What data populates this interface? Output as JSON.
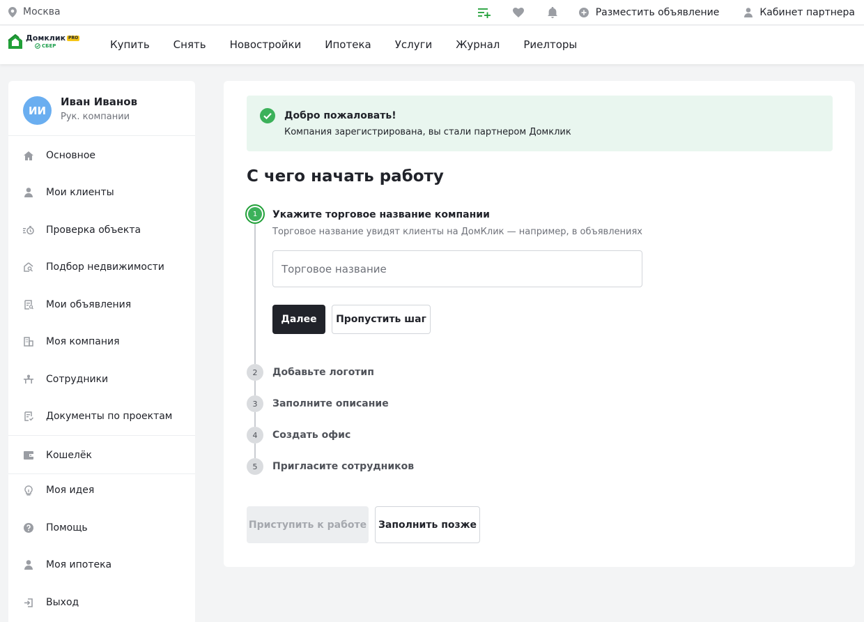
{
  "topbar": {
    "city": "Москва",
    "icons": [
      "add-list-icon",
      "heart-icon",
      "bell-icon"
    ],
    "post_ad": "Разместить объявление",
    "partner_cabinet": "Кабинет партнера"
  },
  "logo": {
    "name": "Домклик",
    "badge": "PRO",
    "sber": "СБЕР"
  },
  "nav": [
    "Купить",
    "Снять",
    "Новостройки",
    "Ипотека",
    "Услуги",
    "Журнал",
    "Риелторы"
  ],
  "profile": {
    "initials": "ИИ",
    "name": "Иван Иванов",
    "role": "Рук. компании"
  },
  "sidebar": {
    "items": [
      {
        "label": "Основное",
        "icon": "home-icon"
      },
      {
        "label": "Мои клиенты",
        "icon": "user-icon"
      },
      {
        "label": "Проверка объекта",
        "icon": "check-object-icon"
      },
      {
        "label": "Подбор недвижимости",
        "icon": "house-search-icon"
      },
      {
        "label": "Мои объявления",
        "icon": "listing-icon"
      },
      {
        "label": "Моя компания",
        "icon": "building-icon"
      },
      {
        "label": "Сотрудники",
        "icon": "staff-icon"
      },
      {
        "label": "Документы по проектам",
        "icon": "documents-icon"
      },
      {
        "label": "Кошелёк",
        "icon": "wallet-icon"
      },
      {
        "label": "Моя идея",
        "icon": "idea-icon"
      },
      {
        "label": "Помощь",
        "icon": "help-icon"
      },
      {
        "label": "Моя ипотека",
        "icon": "user-icon"
      },
      {
        "label": "Выход",
        "icon": "logout-icon"
      }
    ]
  },
  "alert": {
    "title": "Добро пожаловать!",
    "text": "Компания зарегистрирована, вы стали партнером Домклик"
  },
  "main": {
    "heading": "С чего начать работу",
    "step1": {
      "number": "1",
      "title": "Укажите торговое название компании",
      "hint": "Торговое название увидят клиенты на ДомКлик — например, в объявлениях",
      "input_placeholder": "Торговое название",
      "input_value": "",
      "next_label": "Далее",
      "skip_label": "Пропустить шаг"
    },
    "steps": [
      {
        "number": "2",
        "label": "Добавьте логотип"
      },
      {
        "number": "3",
        "label": "Заполните описание"
      },
      {
        "number": "4",
        "label": "Создать офис"
      },
      {
        "number": "5",
        "label": "Пригласите сотрудников"
      }
    ],
    "start_label": "Приступить к работе",
    "later_label": "Заполнить позже"
  },
  "colors": {
    "accent_green": "#21a038",
    "dark_button": "#21232a",
    "alert_bg": "#e9f6ef",
    "avatar": "#6aaef0"
  }
}
